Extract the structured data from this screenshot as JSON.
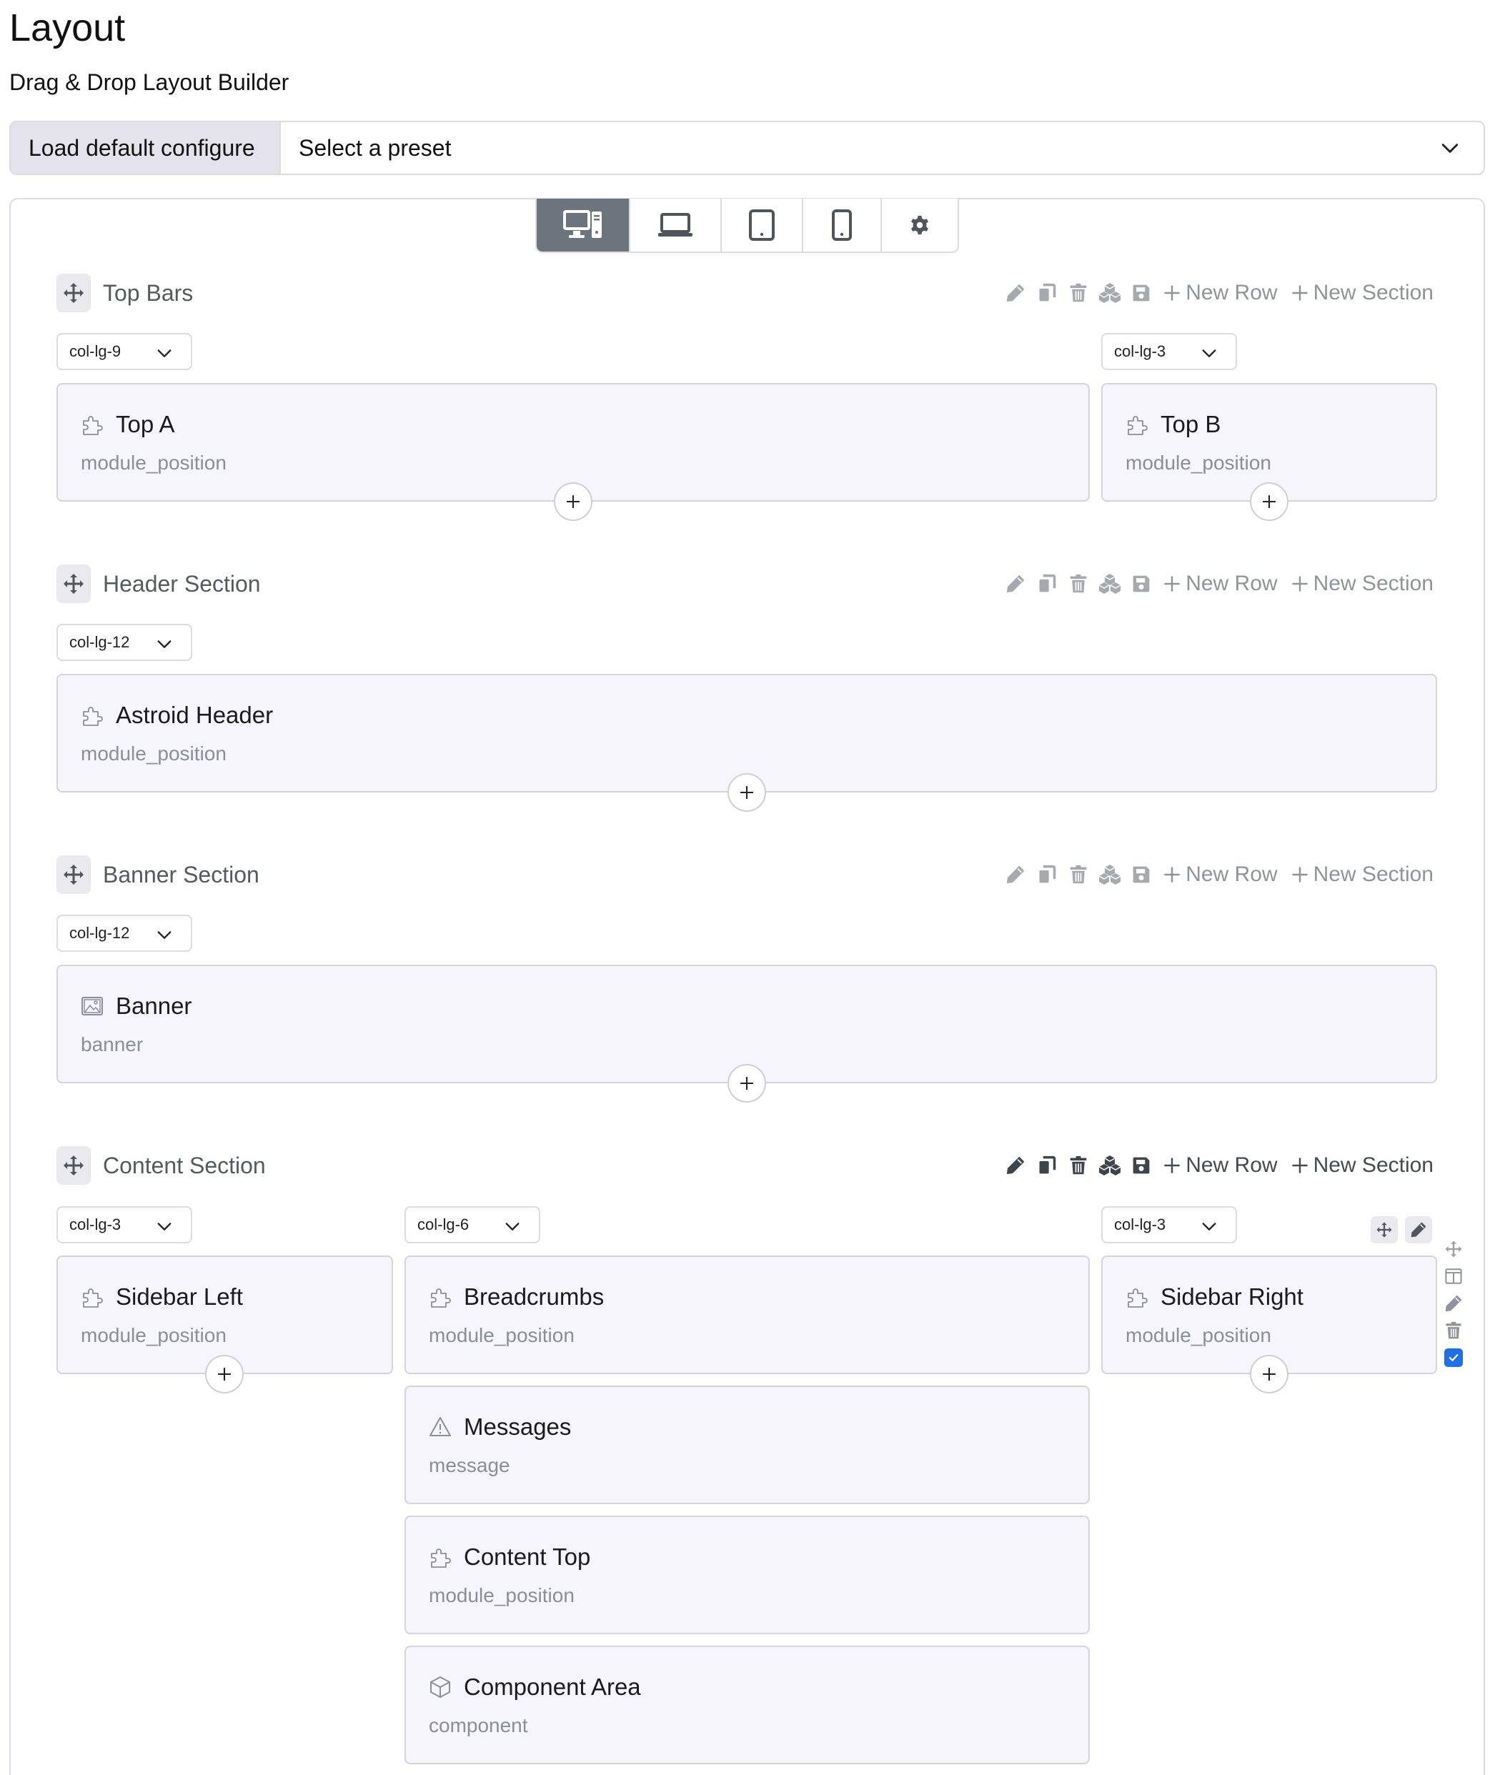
{
  "page": {
    "title": "Layout",
    "subtitle": "Drag & Drop Layout Builder"
  },
  "preset": {
    "load_label": "Load default configure",
    "select_value": "Select a preset"
  },
  "devices": [
    {
      "name": "desktop-icon",
      "active": true
    },
    {
      "name": "laptop-icon",
      "active": false
    },
    {
      "name": "tablet-icon",
      "active": false
    },
    {
      "name": "mobile-icon",
      "active": false
    },
    {
      "name": "gear-icon",
      "active": false
    }
  ],
  "toolbar": {
    "new_row": "New Row",
    "new_section": "New Section"
  },
  "sections": [
    {
      "title": "Top Bars",
      "columns": [
        {
          "size": "col-lg-9",
          "modules": [
            {
              "title": "Top A",
              "type": "module_position",
              "icon": "puzzle-icon"
            }
          ]
        },
        {
          "size": "col-lg-3",
          "modules": [
            {
              "title": "Top B",
              "type": "module_position",
              "icon": "puzzle-icon"
            }
          ]
        }
      ]
    },
    {
      "title": "Header Section",
      "columns": [
        {
          "size": "col-lg-12",
          "modules": [
            {
              "title": "Astroid Header",
              "type": "module_position",
              "icon": "puzzle-icon"
            }
          ]
        }
      ]
    },
    {
      "title": "Banner Section",
      "columns": [
        {
          "size": "col-lg-12",
          "modules": [
            {
              "title": "Banner",
              "type": "banner",
              "icon": "image-icon"
            }
          ]
        }
      ]
    },
    {
      "title": "Content Section",
      "columns": [
        {
          "size": "col-lg-3",
          "modules": [
            {
              "title": "Sidebar Left",
              "type": "module_position",
              "icon": "puzzle-icon"
            }
          ]
        },
        {
          "size": "col-lg-6",
          "modules": [
            {
              "title": "Breadcrumbs",
              "type": "module_position",
              "icon": "puzzle-icon"
            },
            {
              "title": "Messages",
              "type": "message",
              "icon": "warning-icon"
            },
            {
              "title": "Content Top",
              "type": "module_position",
              "icon": "puzzle-icon"
            },
            {
              "title": "Component Area",
              "type": "component",
              "icon": "cube-icon"
            }
          ]
        },
        {
          "size": "col-lg-3",
          "modules": [
            {
              "title": "Sidebar Right",
              "type": "module_position",
              "icon": "puzzle-icon"
            }
          ]
        }
      ]
    }
  ],
  "colors": {
    "module_bg": "#f7f5fc",
    "active_device": "#6c757d",
    "checkbox": "#1f6fe8"
  }
}
